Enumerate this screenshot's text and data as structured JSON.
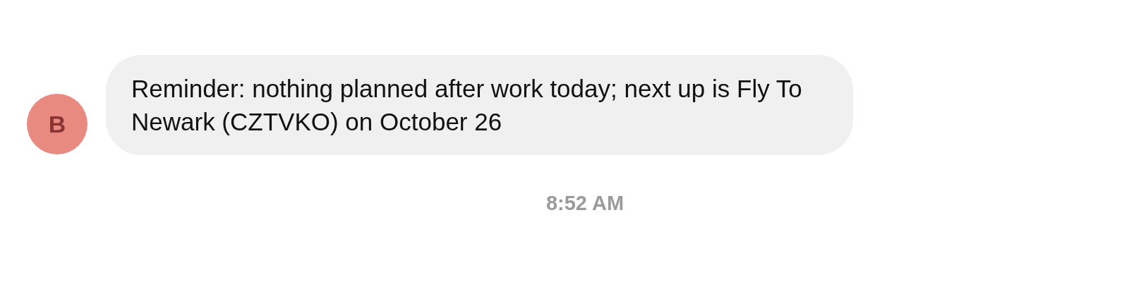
{
  "messages": [
    {
      "avatar": "B",
      "text": "Reminder: nothing planned after work today; next up is Fly To Newark (CZTVKO) on October 26"
    }
  ],
  "timestamp": "8:52 AM"
}
